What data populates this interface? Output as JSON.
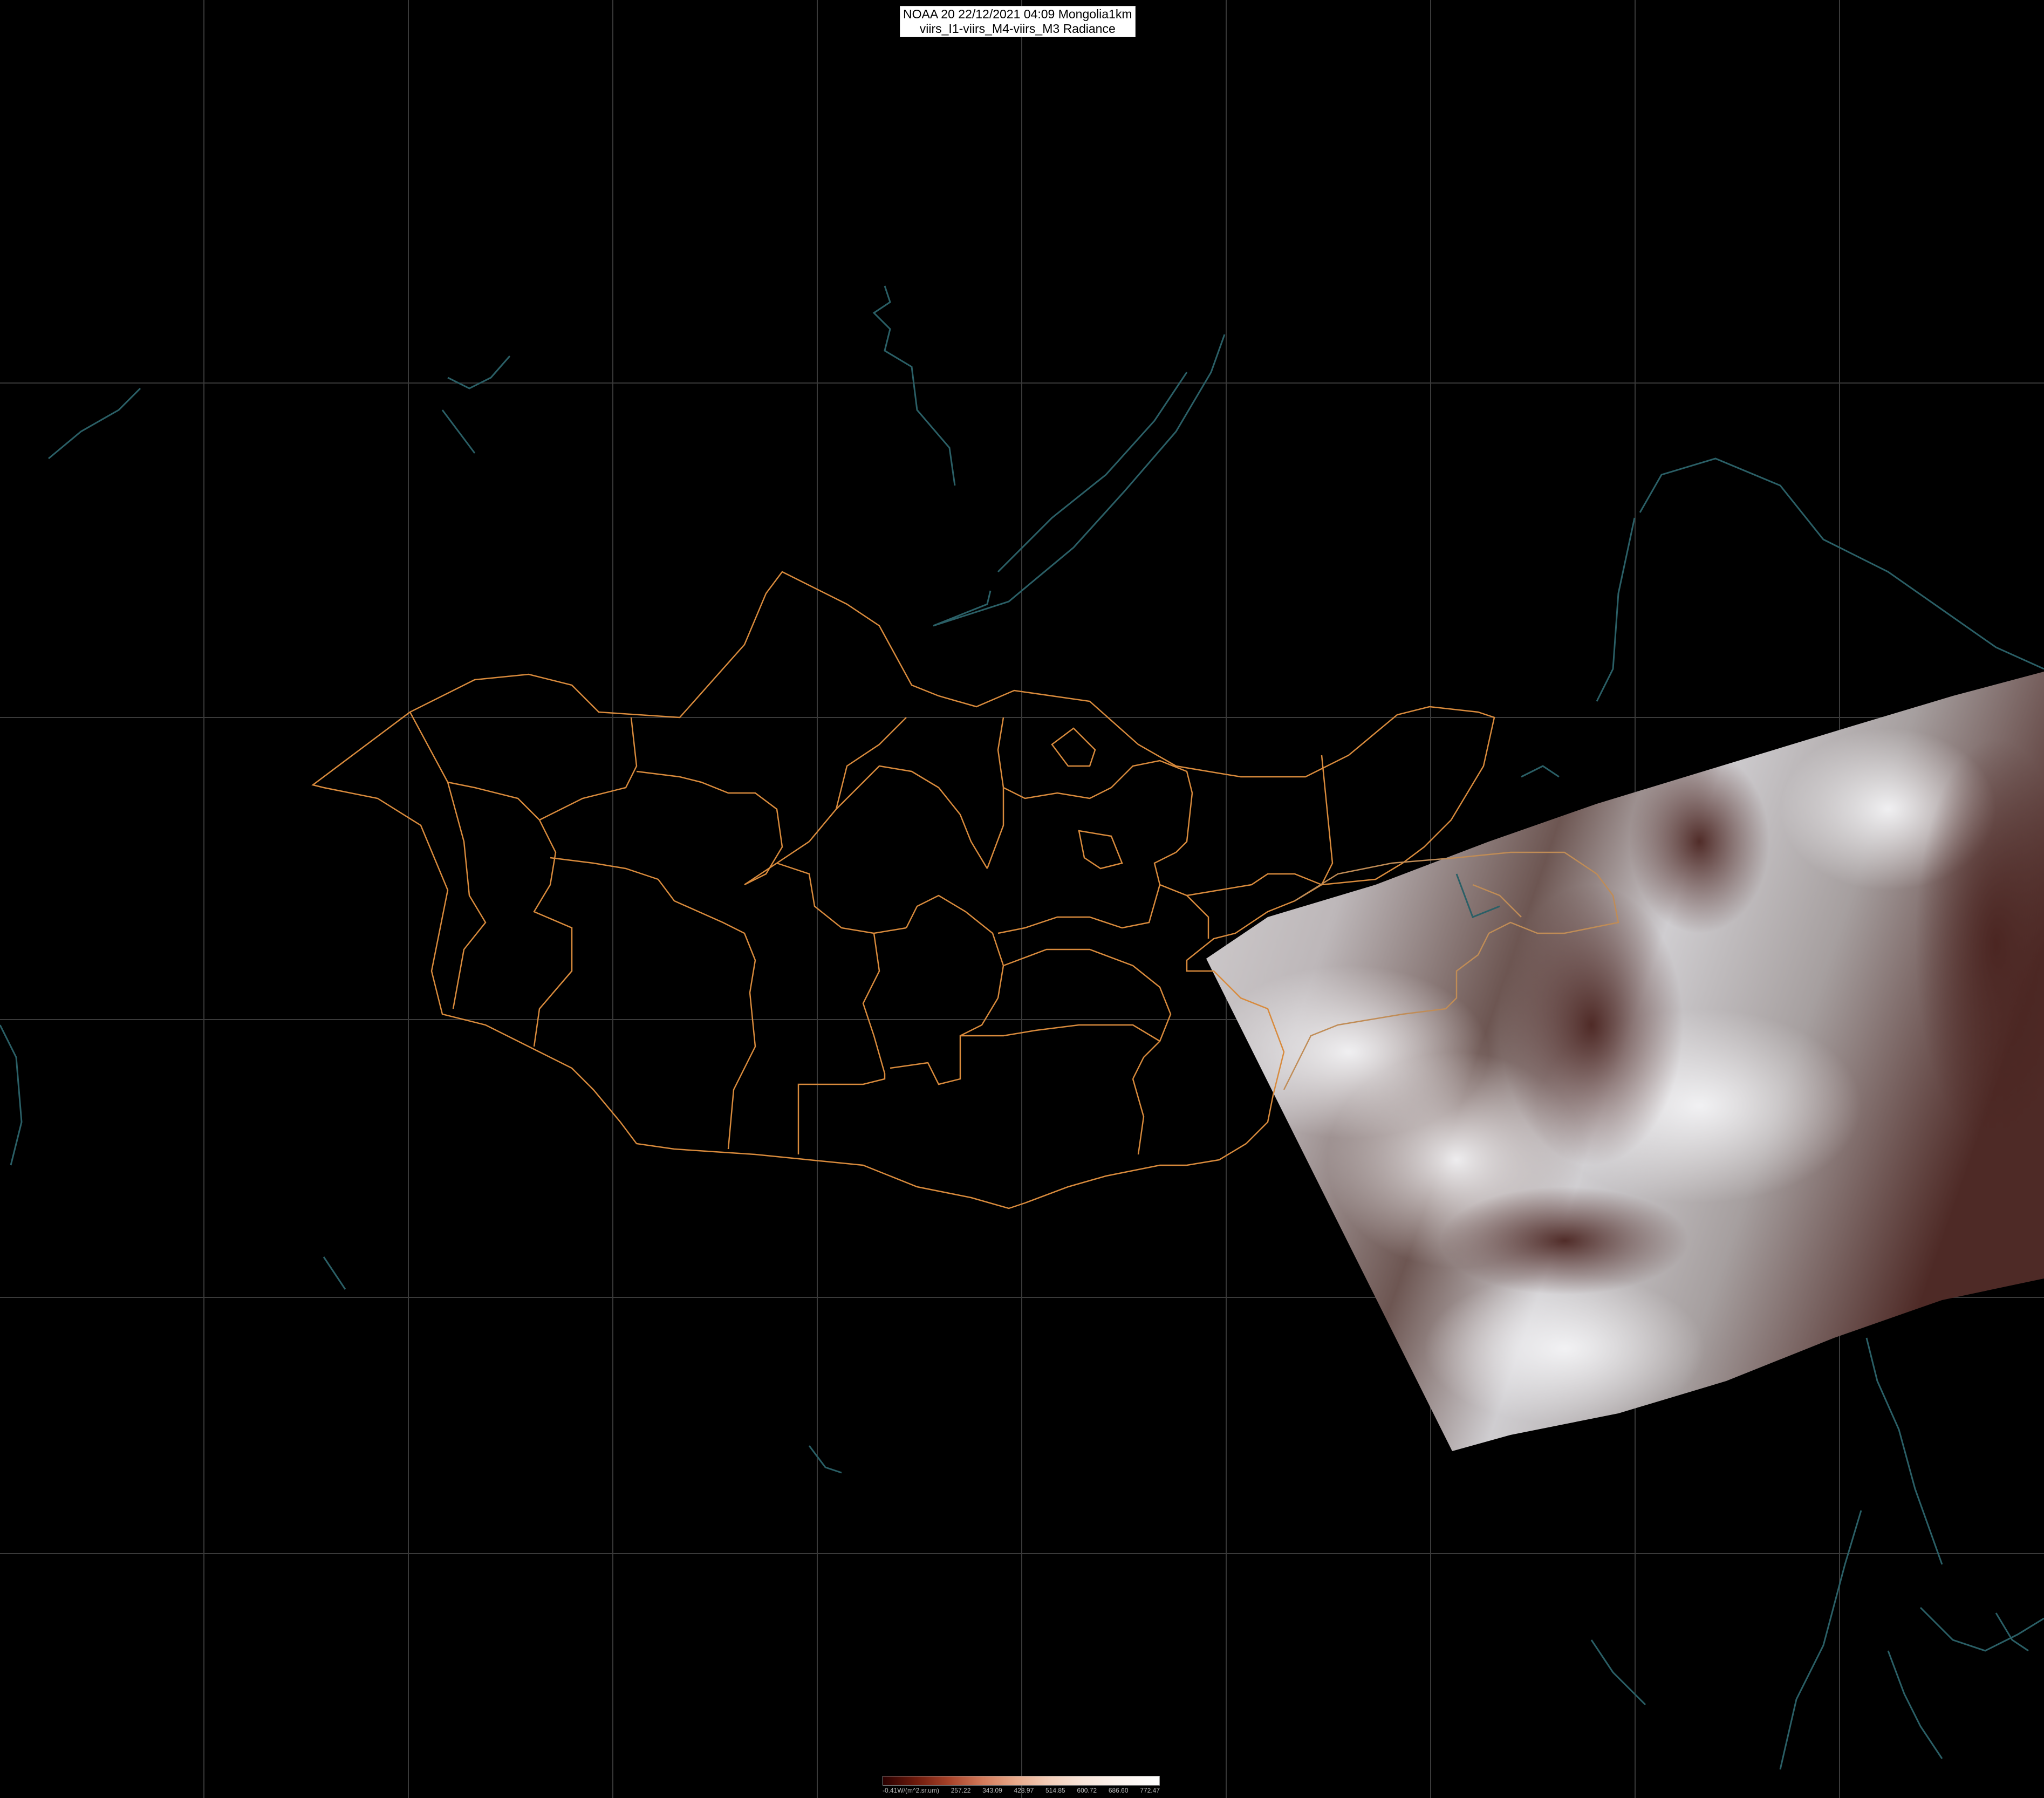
{
  "title": {
    "line1": "NOAA 20 22/12/2021 04:09 Mongolia1km",
    "line2": "viirs_I1-viirs_M4-viirs_M3 Radiance"
  },
  "legend": {
    "ticks": [
      "-0.41W/(m^2.sr.um)",
      "257.22",
      "343.09",
      "428.97",
      "514.85",
      "600.72",
      "686.60",
      "772.47"
    ]
  },
  "colors": {
    "background": "#000000",
    "grid": "#3a3a3a",
    "borders": "#d88a3c",
    "coast": "#2a5f66"
  }
}
